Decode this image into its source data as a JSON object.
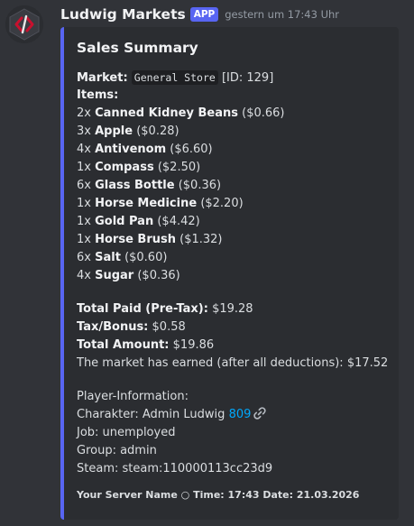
{
  "message": {
    "username": "Ludwig Markets",
    "badge": "APP",
    "timestamp": "gestern um 17:43 Uhr"
  },
  "embed": {
    "title": "Sales Summary",
    "market_label": "Market:",
    "market_name": "General Store",
    "market_id": "[ID: 129]",
    "items_label": "Items:",
    "items": [
      {
        "qty": "2x",
        "name": "Canned Kidney Beans",
        "price": "($0.66)"
      },
      {
        "qty": "3x",
        "name": "Apple",
        "price": "($0.28)"
      },
      {
        "qty": "4x",
        "name": "Antivenom",
        "price": "($6.60)"
      },
      {
        "qty": "1x",
        "name": "Compass",
        "price": "($2.50)"
      },
      {
        "qty": "6x",
        "name": "Glass Bottle",
        "price": "($0.36)"
      },
      {
        "qty": "1x",
        "name": "Horse Medicine",
        "price": "($2.20)"
      },
      {
        "qty": "1x",
        "name": "Gold Pan",
        "price": "($4.42)"
      },
      {
        "qty": "1x",
        "name": "Horse Brush",
        "price": "($1.32)"
      },
      {
        "qty": "6x",
        "name": "Salt",
        "price": "($0.60)"
      },
      {
        "qty": "4x",
        "name": "Sugar",
        "price": "($0.36)"
      }
    ],
    "totals": {
      "paid_label": "Total Paid (Pre-Tax):",
      "paid_value": "$19.28",
      "tax_label": "Tax/Bonus:",
      "tax_value": "$0.58",
      "amount_label": "Total Amount:",
      "amount_value": "$19.86",
      "earned_text": "The market has earned (after all deductions): $17.52"
    },
    "player": {
      "heading": "Player-Information:",
      "charakter_label": "Charakter: Admin Ludwig",
      "charakter_id": "809",
      "job": "Job: unemployed",
      "group": "Group: admin",
      "steam": "Steam: steam:110000113cc23d9"
    },
    "footer": "Your Server Name ○ Time: 17:43 Date: 21.03.2026"
  },
  "icons": {
    "avatar": "ludwig-logo",
    "link": "link-icon"
  },
  "colors": {
    "background": "#313338",
    "embed_bg": "#2b2d31",
    "accent": "#5865f2",
    "link": "#00a8fc",
    "avatar_red": "#c8102e"
  }
}
